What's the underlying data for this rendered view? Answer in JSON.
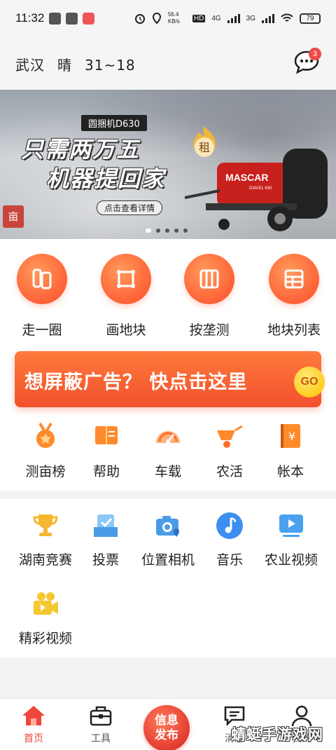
{
  "status_bar": {
    "time": "11:32",
    "net_speed": "56.4 KB/s",
    "hd": "HD",
    "net1": "4G",
    "net2": "3G",
    "battery": "79"
  },
  "header": {
    "city": "武汉",
    "weather": "晴",
    "temperature": "31~18",
    "message_badge": "3"
  },
  "banner": {
    "model": "圆捆机D630",
    "headline_line1": "只需两万五",
    "headline_line2": "机器提回家",
    "detail_link": "点击查看详情",
    "rent_tag": "租",
    "mu_tag": "亩",
    "machine_brand": "MASCAR",
    "machine_model": "DIAVEL 630",
    "slides": 5,
    "active_slide": 1
  },
  "main_tools": [
    {
      "label": "走一圈",
      "icon": "walk-measure-icon"
    },
    {
      "label": "画地块",
      "icon": "draw-plot-icon"
    },
    {
      "label": "按垄测",
      "icon": "ridge-measure-icon"
    },
    {
      "label": "地块列表",
      "icon": "plot-list-icon"
    }
  ],
  "ad_bar": {
    "text": "想屏蔽广告？ 快点击这里",
    "go": "GO"
  },
  "secondary_tools": [
    {
      "label": "测亩榜",
      "icon": "medal-icon"
    },
    {
      "label": "帮助",
      "icon": "help-book-icon"
    },
    {
      "label": "车载",
      "icon": "speedometer-icon"
    },
    {
      "label": "农活",
      "icon": "wheelbarrow-icon"
    },
    {
      "label": "帐本",
      "icon": "ledger-icon"
    }
  ],
  "extra_tools": [
    {
      "label": "湖南竞赛",
      "icon": "trophy-icon"
    },
    {
      "label": "投票",
      "icon": "vote-icon"
    },
    {
      "label": "位置相机",
      "icon": "location-camera-icon"
    },
    {
      "label": "音乐",
      "icon": "music-icon"
    },
    {
      "label": "农业视频",
      "icon": "video-play-icon"
    },
    {
      "label": "精彩视频",
      "icon": "video-camera-icon"
    }
  ],
  "bottom_nav": {
    "home": "首页",
    "tools": "工具",
    "publish": "信息发布",
    "publish_line1": "信息",
    "publish_line2": "发布",
    "messages": "消息",
    "profile": "我的"
  },
  "watermark": "蜻蜓手游戏网",
  "colors": {
    "accent": "#ff5e35",
    "active_nav": "#f0453a",
    "go_button": "#ffcd1f"
  }
}
